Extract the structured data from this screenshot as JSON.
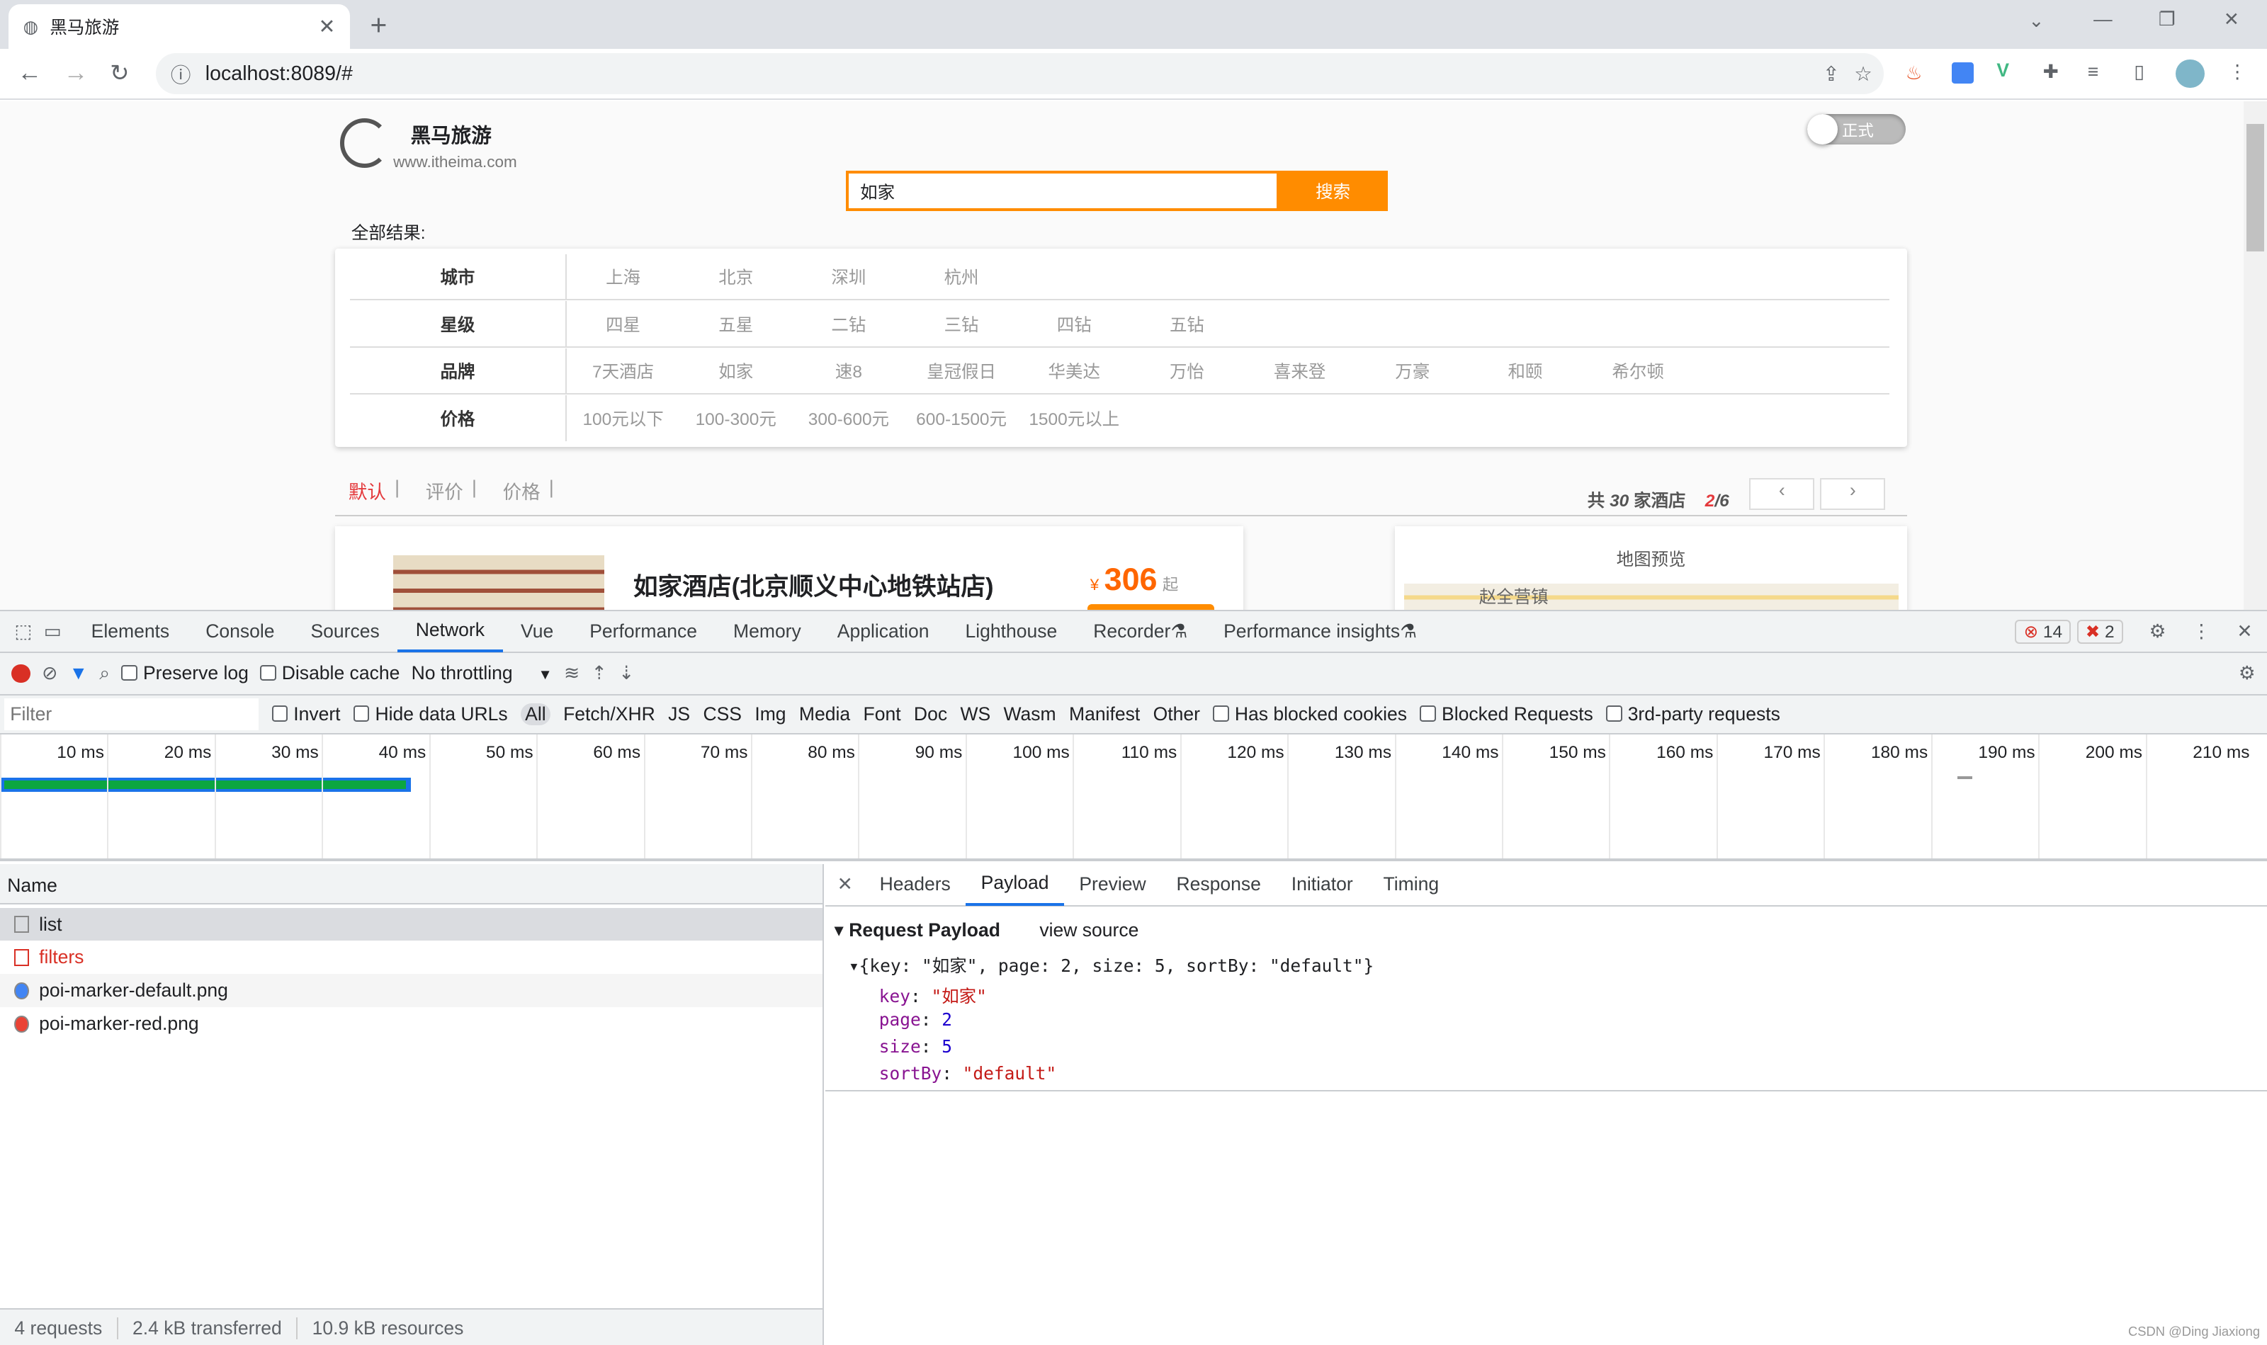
{
  "browser": {
    "tab_title": "黑马旅游",
    "url": "localhost:8089/#"
  },
  "site": {
    "logo_title": "黑马旅游",
    "logo_url": "www.itheima.com",
    "toggle_label": "正式",
    "search_value": "如家",
    "search_button": "搜索",
    "all_results": "全部结果:"
  },
  "filters": [
    {
      "label": "城市",
      "options": [
        "上海",
        "北京",
        "深圳",
        "杭州"
      ]
    },
    {
      "label": "星级",
      "options": [
        "四星",
        "五星",
        "二钻",
        "三钻",
        "四钻",
        "五钻"
      ]
    },
    {
      "label": "品牌",
      "options": [
        "7天酒店",
        "如家",
        "速8",
        "皇冠假日",
        "华美达",
        "万怡",
        "喜来登",
        "万豪",
        "和颐",
        "希尔顿"
      ]
    },
    {
      "label": "价格",
      "options": [
        "100元以下",
        "100-300元",
        "300-600元",
        "600-1500元",
        "1500元以上"
      ]
    }
  ],
  "sort": {
    "default": "默认",
    "rating": "评价",
    "price": "价格",
    "sep": "|"
  },
  "pagination": {
    "prefix": "共",
    "total": "30",
    "suffix": "家酒店",
    "current": "2",
    "pages": "/6"
  },
  "hotel": {
    "name": "如家酒店(北京顺义中心地铁站店)",
    "currency": "¥",
    "price": "306",
    "price_suffix": "起"
  },
  "map": {
    "title": "地图预览",
    "place": "赵全营镇"
  },
  "devtools": {
    "tabs": [
      "Elements",
      "Console",
      "Sources",
      "Network",
      "Vue",
      "Performance",
      "Memory",
      "Application",
      "Lighthouse",
      "Recorder",
      "Performance insights"
    ],
    "active_tab": "Network",
    "errors": "14",
    "issues": "2",
    "toolbar": {
      "preserve_log": "Preserve log",
      "disable_cache": "Disable cache",
      "throttling": "No throttling"
    },
    "filter_placeholder": "Filter",
    "invert": "Invert",
    "hide_data_urls": "Hide data URLs",
    "types": [
      "All",
      "Fetch/XHR",
      "JS",
      "CSS",
      "Img",
      "Media",
      "Font",
      "Doc",
      "WS",
      "Wasm",
      "Manifest",
      "Other"
    ],
    "blocked_cookies": "Has blocked cookies",
    "blocked_requests": "Blocked Requests",
    "third_party": "3rd-party requests",
    "ticks": [
      "10 ms",
      "20 ms",
      "30 ms",
      "40 ms",
      "50 ms",
      "60 ms",
      "70 ms",
      "80 ms",
      "90 ms",
      "100 ms",
      "110 ms",
      "120 ms",
      "130 ms",
      "140 ms",
      "150 ms",
      "160 ms",
      "170 ms",
      "180 ms",
      "190 ms",
      "200 ms",
      "210 ms"
    ],
    "name_header": "Name",
    "requests": [
      {
        "name": "list",
        "status": "selected"
      },
      {
        "name": "filters",
        "status": "error"
      },
      {
        "name": "poi-marker-default.png",
        "status": "ok"
      },
      {
        "name": "poi-marker-red.png",
        "status": "ok"
      }
    ],
    "detail_tabs": [
      "Headers",
      "Payload",
      "Preview",
      "Response",
      "Initiator",
      "Timing"
    ],
    "active_detail": "Payload",
    "payload": {
      "title": "Request Payload",
      "view_source": "view source",
      "summary": "{key: \"如家\", page: 2, size: 5, sortBy: \"default\"}",
      "fields": [
        {
          "k": "key",
          "v": "\"如家\"",
          "t": "str"
        },
        {
          "k": "page",
          "v": "2",
          "t": "num"
        },
        {
          "k": "size",
          "v": "5",
          "t": "num"
        },
        {
          "k": "sortBy",
          "v": "\"default\"",
          "t": "str"
        }
      ]
    },
    "status": {
      "requests": "4 requests",
      "transferred": "2.4 kB transferred",
      "resources": "10.9 kB resources"
    }
  },
  "watermark": "CSDN @Ding Jiaxiong",
  "colors": {
    "accent": "#ff8c00",
    "devtools_blue": "#1a73e8",
    "error": "#d93025"
  }
}
